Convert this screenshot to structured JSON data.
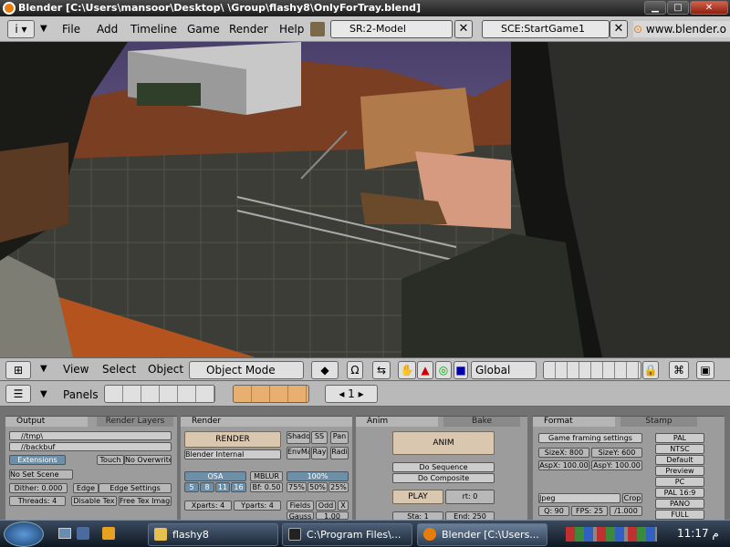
{
  "window": {
    "title": "Blender [C:\\Users\\mansoor\\Desktop\\  \\Group\\flashy8\\OnlyForTray.blend]",
    "controls": [
      "minimize",
      "maximize",
      "close"
    ]
  },
  "menubar": {
    "items": [
      "File",
      "Add",
      "Timeline",
      "Game",
      "Render",
      "Help"
    ],
    "screen_select": "SR:2-Model",
    "scene_select": "SCE:StartGame1",
    "url": "www.blender.o"
  },
  "view3d_header": {
    "menus": [
      "View",
      "Select",
      "Object"
    ],
    "mode": "Object Mode",
    "orientation": "Global"
  },
  "buttons_header": {
    "panels_label": "Panels",
    "frame": "1"
  },
  "panel_output": {
    "tabs": [
      "Output",
      "Render Layers"
    ],
    "path1": "//tmp\\",
    "path2": "//backbuf",
    "extensions": "Extensions",
    "touch": "Touch",
    "no_overwrite": "No Overwrite",
    "no_set_scene": "No Set Scene",
    "dither": "Dither: 0.000",
    "edge": "Edge",
    "edge_settings": "Edge Settings",
    "threads": "Threads: 4",
    "disable_tex": "Disable Tex",
    "free_tex_image": "Free Tex Image"
  },
  "panel_render": {
    "tab": "Render",
    "render_button": "RENDER",
    "renderer": "Blender Internal",
    "shadow": "Shado",
    "sss": "SS",
    "pano": "Pan",
    "envmap": "EnvMa",
    "ray": "Ray",
    "radio": "Radi",
    "osa": "OSA",
    "mblur": "MBLUR",
    "osa_levels": [
      "5",
      "8",
      "11",
      "16"
    ],
    "bf": "Bf: 0.50",
    "percent": "100%",
    "percents": [
      "75%",
      "50%",
      "25%"
    ],
    "xparts": "Xparts: 4",
    "yparts": "Yparts: 4",
    "fields": "Fields",
    "odd": "Odd",
    "x": "X",
    "gauss": "Gauss",
    "gauss_val": "1.00"
  },
  "panel_anim": {
    "tabs": [
      "Anim",
      "Bake"
    ],
    "anim_button": "ANIM",
    "do_sequence": "Do Sequence",
    "do_composite": "Do Composite",
    "play": "PLAY",
    "rt": "rt: 0",
    "sta": "Sta: 1",
    "end": "End: 250"
  },
  "panel_format": {
    "tabs": [
      "Format",
      "Stamp"
    ],
    "game_framing": "Game framing settings",
    "sizex": "SizeX: 800",
    "sizey": "SizeY: 600",
    "aspx": "AspX: 100.00",
    "aspy": "AspY: 100.00",
    "presets": [
      "PAL",
      "NTSC",
      "Default",
      "Preview",
      "PC",
      "PAL 16:9",
      "PANO",
      "FULL"
    ],
    "format": "Jpeg",
    "crop": "Crop",
    "quality": "Q: 90",
    "fps": "FPS: 25",
    "fps_base": "/1.000"
  },
  "taskbar": {
    "tasks": [
      "flashy8",
      "C:\\Program Files\\...",
      "Blender [C:\\Users..."
    ],
    "clock": "11:17 م"
  },
  "colors": {
    "blender_orange": "#e87d0d",
    "ui_gray": "#9c9c9c",
    "button_blue": "#6e8fa8"
  }
}
